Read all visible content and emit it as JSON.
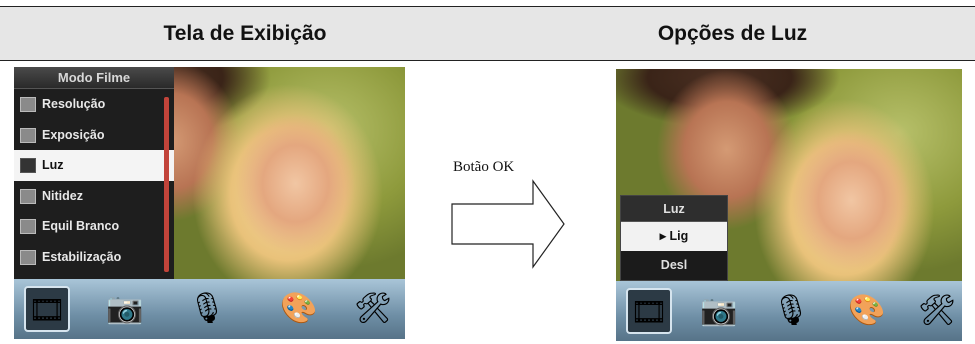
{
  "header": {
    "left_title": "Tela de Exibição",
    "right_title": "Opções de Luz"
  },
  "left_screen": {
    "menu_title": "Modo Filme",
    "menu_items": [
      {
        "label": "Resolução",
        "icon": "resolution-icon",
        "selected": false
      },
      {
        "label": "Exposição",
        "icon": "exposure-icon",
        "selected": false
      },
      {
        "label": "Luz",
        "icon": "light-icon",
        "selected": true
      },
      {
        "label": "Nitidez",
        "icon": "sharpness-icon",
        "selected": false
      },
      {
        "label": "Equil Branco",
        "icon": "white-balance-icon",
        "selected": false
      },
      {
        "label": "Estabilização",
        "icon": "stabilization-icon",
        "selected": false
      }
    ]
  },
  "transition": {
    "label": "Botão OK",
    "icon": "right-arrow-icon"
  },
  "right_screen": {
    "popup_title": "Luz",
    "options": [
      {
        "label": "▸ Lig",
        "selected": true
      },
      {
        "label": "Desl",
        "selected": false
      }
    ]
  },
  "tabbar": {
    "tabs": [
      {
        "icon": "film-reel-icon",
        "glyph": "🎞",
        "active": true
      },
      {
        "icon": "camera-icon",
        "glyph": "📷",
        "active": false
      },
      {
        "icon": "microphone-icon",
        "glyph": "🎙",
        "active": false
      },
      {
        "icon": "palette-icon",
        "glyph": "🎨",
        "active": false
      },
      {
        "icon": "tools-icon",
        "glyph": "🛠",
        "active": false
      }
    ]
  },
  "colors": {
    "menu_selected_bg": "#f4f4f4",
    "menu_bg": "#1e1e1e",
    "scrollbar": "#c2443a",
    "tabbar": "#6f8fa6"
  }
}
